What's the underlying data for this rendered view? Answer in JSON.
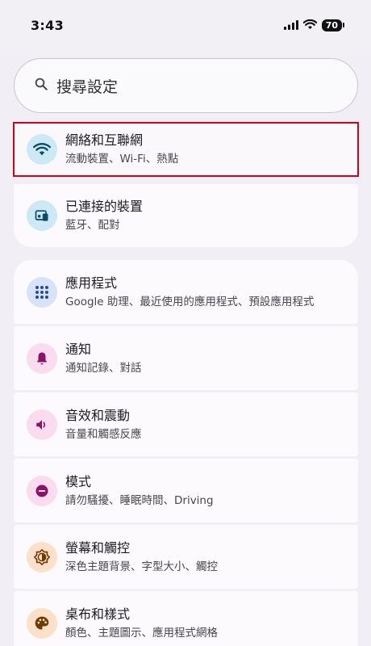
{
  "status_bar": {
    "time": "3:43",
    "battery": "70"
  },
  "search": {
    "placeholder": "搜尋設定"
  },
  "items": [
    {
      "title": "網絡和互聯網",
      "subtitle": "流動裝置、Wi-Fi、熱點",
      "icon": "wifi-icon",
      "icon_bg": "#cde9f6",
      "icon_color": "#0b4c66"
    },
    {
      "title": "已連接的裝置",
      "subtitle": "藍牙、配對",
      "icon": "connected-devices-icon",
      "icon_bg": "#cde9f6",
      "icon_color": "#0b4c66"
    },
    {
      "title": "應用程式",
      "subtitle": "Google 助理、最近使用的應用程式、預設應用程式",
      "icon": "apps-grid-icon",
      "icon_bg": "#d7e2fb",
      "icon_color": "#2d4a8f"
    },
    {
      "title": "通知",
      "subtitle": "通知記錄、對話",
      "icon": "bell-icon",
      "icon_bg": "#fadbf0",
      "icon_color": "#8b1366"
    },
    {
      "title": "音效和震動",
      "subtitle": "音量和觸感反應",
      "icon": "volume-icon",
      "icon_bg": "#fadbf0",
      "icon_color": "#8b1366"
    },
    {
      "title": "模式",
      "subtitle": "請勿騷擾、睡眠時間、Driving",
      "icon": "do-not-disturb-icon",
      "icon_bg": "#fadbf0",
      "icon_color": "#8b1366"
    },
    {
      "title": "螢幕和觸控",
      "subtitle": "深色主題背景、字型大小、觸控",
      "icon": "brightness-icon",
      "icon_bg": "#fde0c9",
      "icon_color": "#6e3a05"
    },
    {
      "title": "桌布和樣式",
      "subtitle": "顏色、主題圖示、應用程式網格",
      "icon": "palette-icon",
      "icon_bg": "#fde0c9",
      "icon_color": "#6e3a05"
    }
  ],
  "highlight_color": "#d0021b"
}
